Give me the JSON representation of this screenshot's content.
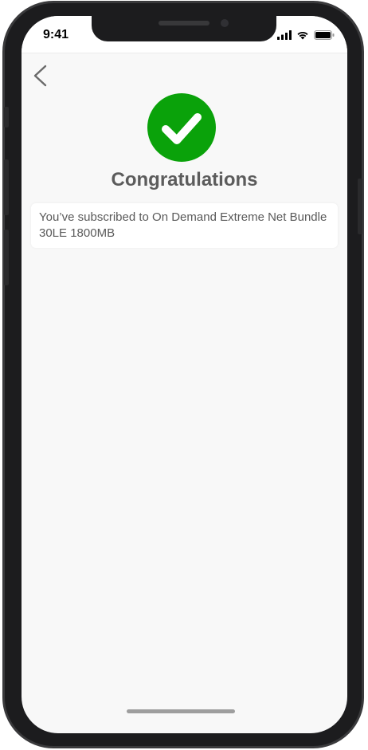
{
  "status_bar": {
    "time": "9:41",
    "signal_icon": "cellular-signal-icon",
    "wifi_icon": "wifi-icon",
    "battery_icon": "battery-icon"
  },
  "navigation": {
    "back_icon": "chevron-left-icon"
  },
  "success": {
    "icon": "check-circle-icon",
    "color": "#0aa20a",
    "title": "Congratulations",
    "message": "You’ve subscribed to On Demand Extreme Net Bundle 30LE 1800MB"
  }
}
